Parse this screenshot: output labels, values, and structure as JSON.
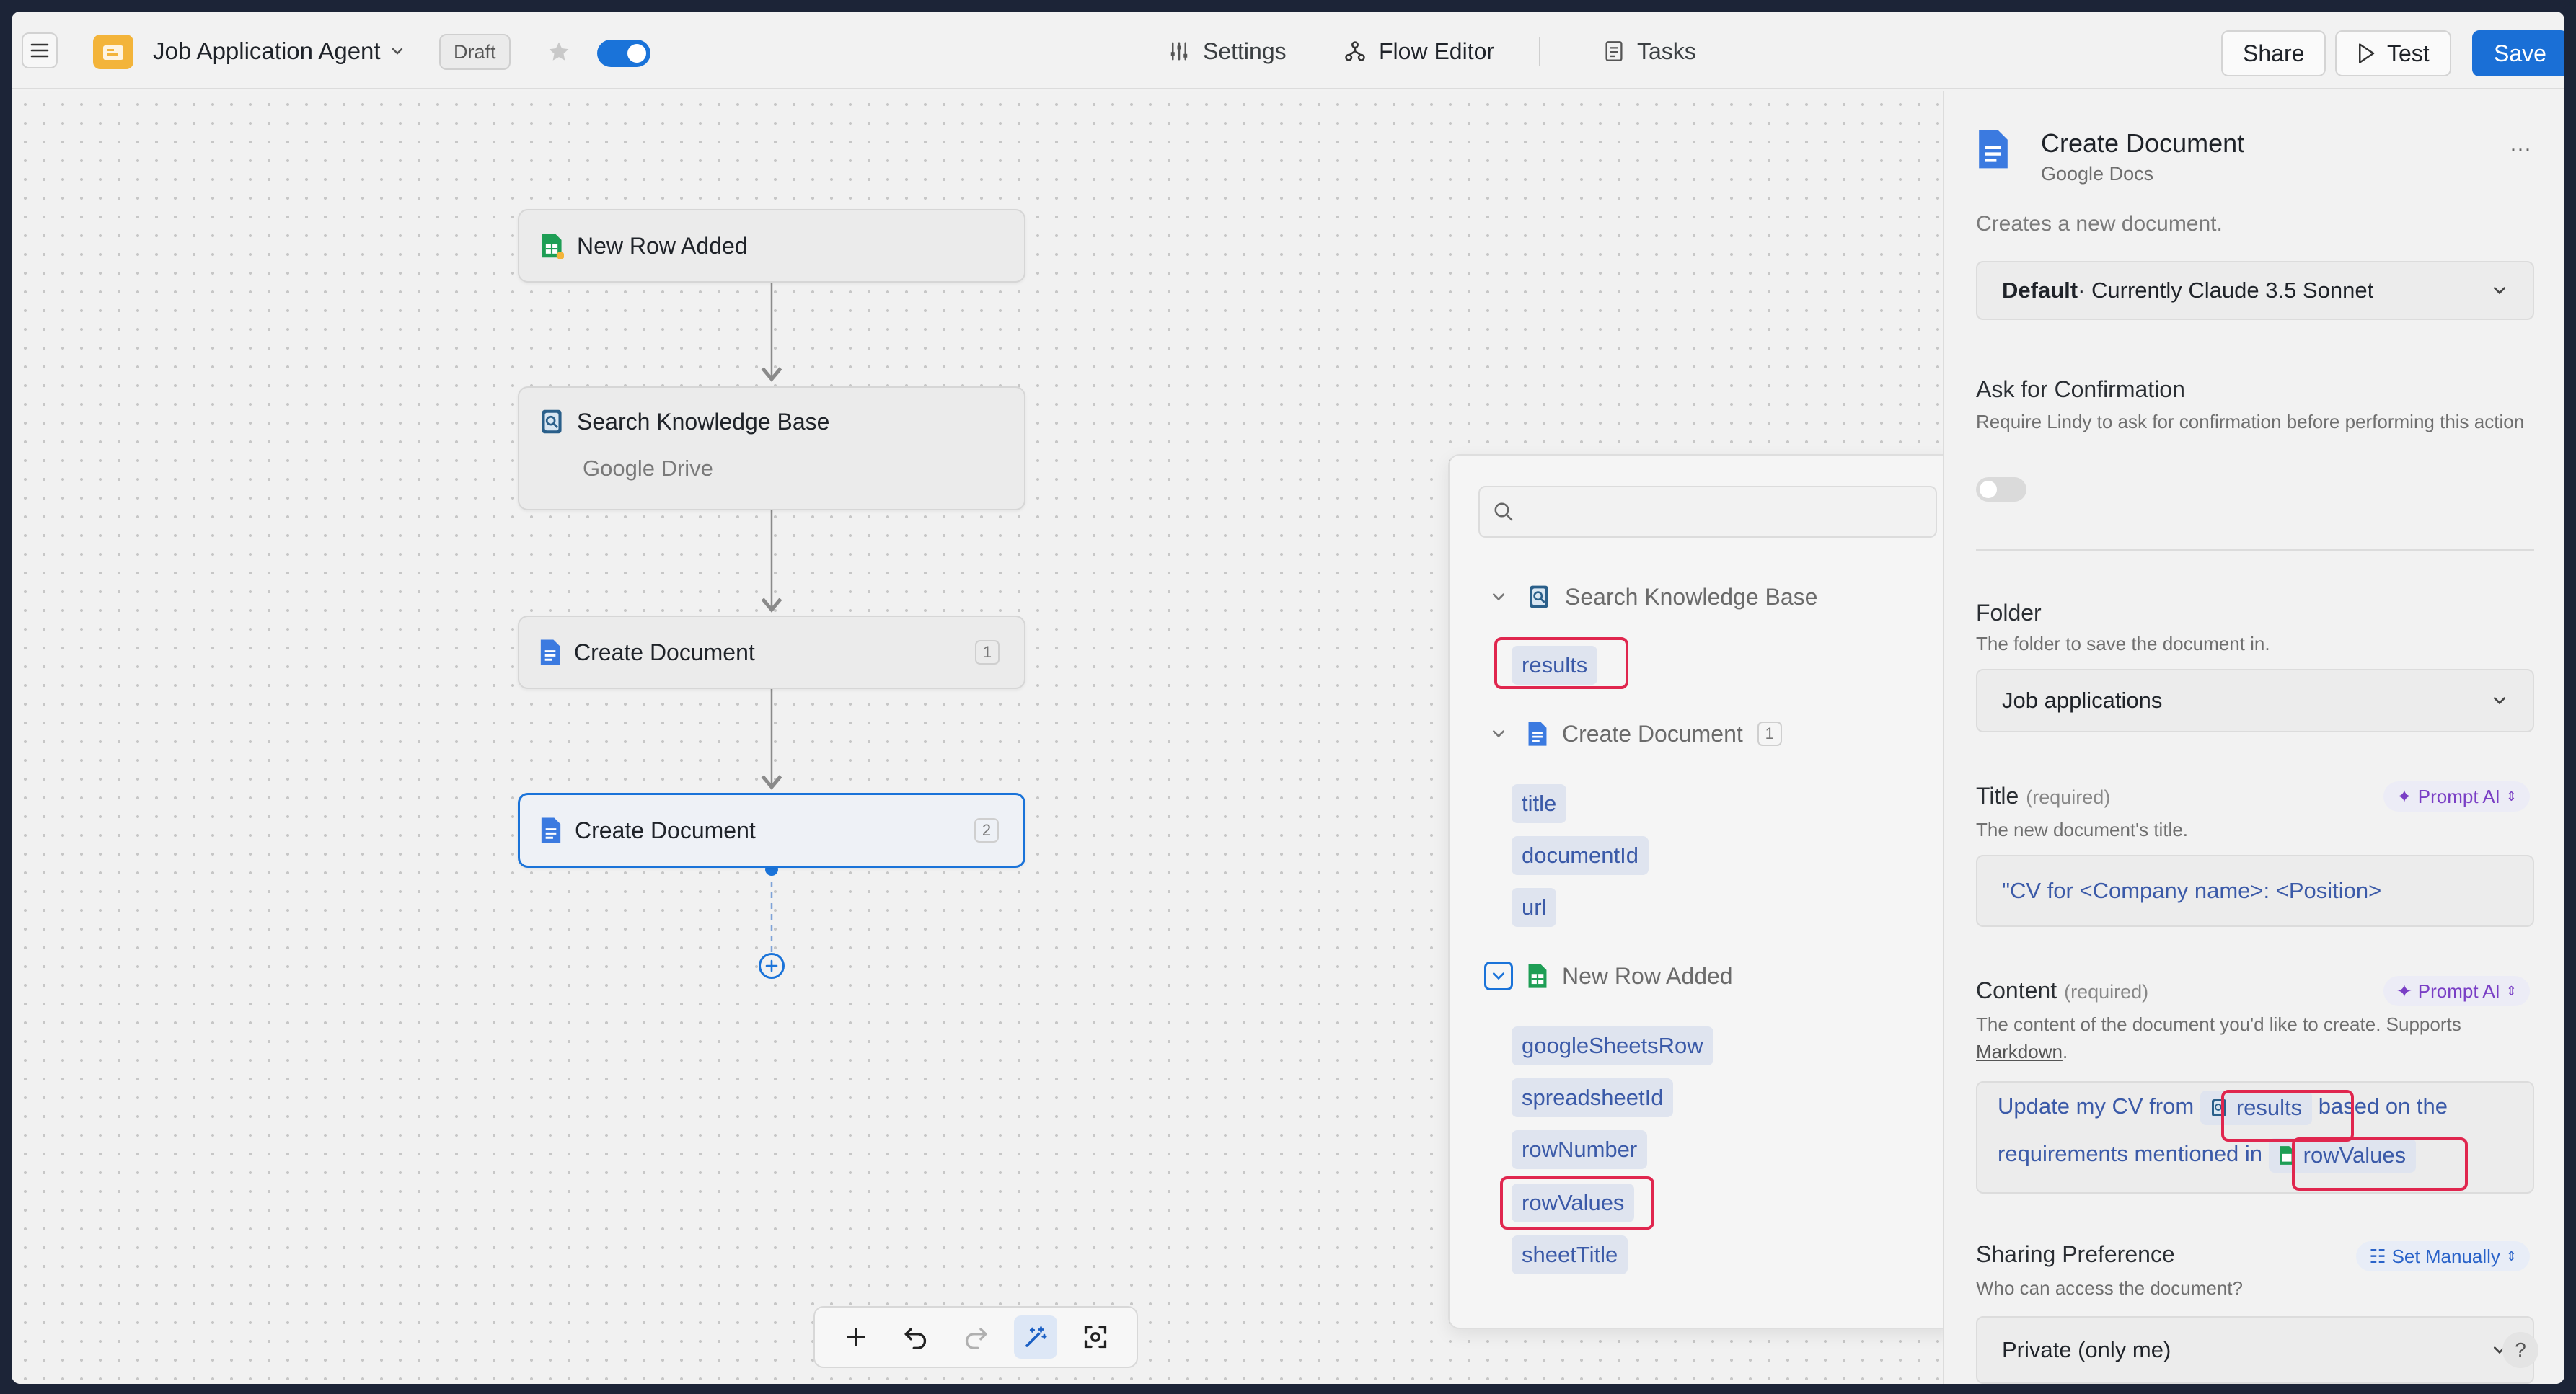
{
  "header": {
    "app_name": "Job Application Agent",
    "status": "Draft",
    "tabs": [
      {
        "label": "Settings",
        "icon": "sliders-icon"
      },
      {
        "label": "Flow Editor",
        "icon": "flow-icon"
      },
      {
        "label": "Tasks",
        "icon": "tasks-icon"
      }
    ],
    "actions": {
      "share": "Share",
      "test": "Test",
      "save": "Save"
    }
  },
  "flow": {
    "nodes": [
      {
        "title": "New Row Added",
        "icon": "google-sheets-icon"
      },
      {
        "title": "Search Knowledge Base",
        "subtitle": "Google Drive",
        "icon": "knowledge-base-icon"
      },
      {
        "title": "Create Document",
        "badge": "1",
        "icon": "google-docs-icon"
      },
      {
        "title": "Create Document",
        "badge": "2",
        "icon": "google-docs-icon"
      }
    ]
  },
  "picker": {
    "search_placeholder": "",
    "groups": [
      {
        "title": "Search Knowledge Base",
        "variables": [
          "results"
        ]
      },
      {
        "title": "Create Document",
        "badge": "1",
        "variables": [
          "title",
          "documentId",
          "url"
        ]
      },
      {
        "title": "New Row Added",
        "variables": [
          "googleSheetsRow",
          "spreadsheetId",
          "rowNumber",
          "rowValues",
          "sheetTitle"
        ]
      }
    ]
  },
  "panel": {
    "title": "Create Document",
    "subtitle": "Google Docs",
    "description": "Creates a new document.",
    "model": {
      "main": "Default",
      "detail": " · Currently Claude 3.5 Sonnet"
    },
    "confirmation": {
      "label": "Ask for Confirmation",
      "help": "Require Lindy to ask for confirmation before performing this action"
    },
    "folder": {
      "label": "Folder",
      "help": "The folder to save the document in.",
      "value": "Job applications"
    },
    "title_field": {
      "label": "Title",
      "required": "(required)",
      "help": "The new document's title.",
      "mode": "Prompt AI",
      "value": "\"CV for <Company name>: <Position>"
    },
    "content_field": {
      "label": "Content",
      "required": "(required)",
      "help_prefix": "The content of the document you'd like to create. Supports ",
      "help_link": "Markdown",
      "help_suffix": ".",
      "mode": "Prompt AI",
      "text1": "Update my CV from ",
      "chip1": "results",
      "text2": " based on the requirements mentioned in ",
      "chip2": "rowValues"
    },
    "sharing": {
      "label": "Sharing Preference",
      "help": "Who can access the document?",
      "mode": "Set Manually",
      "value": "Private (only me)"
    },
    "help_button": "?"
  },
  "colors": {
    "accent": "#1a73d9",
    "highlight": "#e0264e",
    "prompt_ai": "#7a3fc5"
  }
}
